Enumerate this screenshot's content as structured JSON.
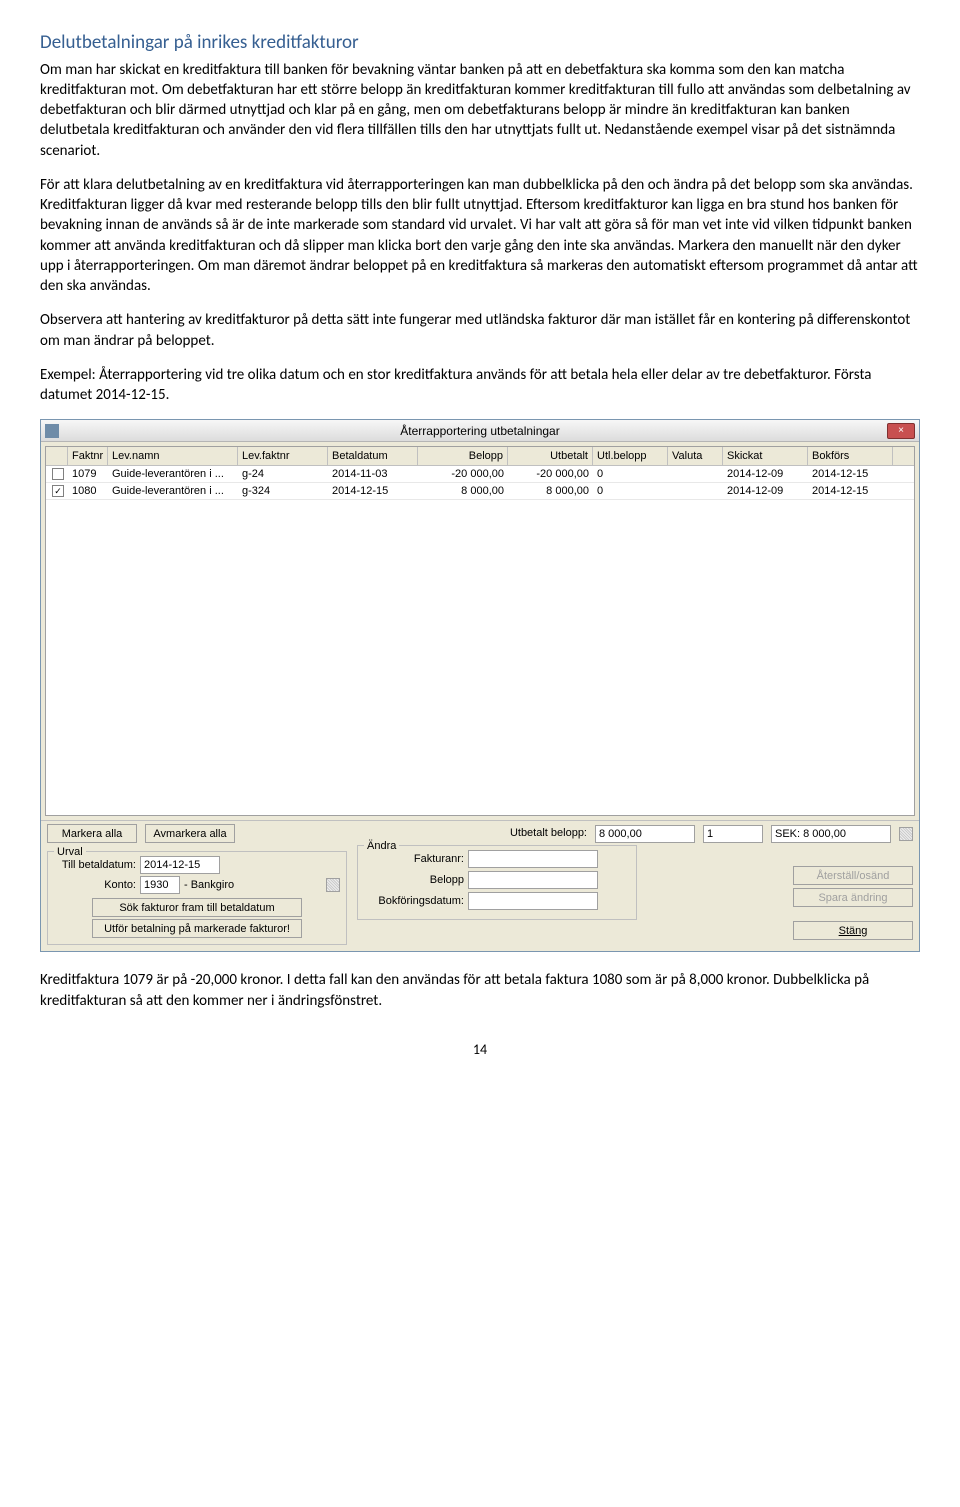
{
  "heading": "Delutbetalningar på inrikes kreditfakturor",
  "para1": "Om man har skickat en kreditfaktura till banken för bevakning väntar banken på att en debetfaktura ska komma som den kan matcha kreditfakturan mot. Om debetfakturan har ett större belopp än kreditfakturan kommer kreditfakturan till fullo att användas som delbetalning av debetfakturan och blir därmed utnyttjad och klar på en gång, men om debetfakturans belopp är mindre än kreditfakturan kan banken delutbetala kreditfakturan och använder den vid flera tillfällen tills den har utnyttjats fullt ut. Nedanstående exempel visar på det sistnämnda scenariot.",
  "para2": "För att klara delutbetalning av en kreditfaktura vid återrapporteringen kan man dubbelklicka på den och ändra på det belopp som ska användas. Kreditfakturan ligger då kvar med resterande belopp tills den blir fullt utnyttjad. Eftersom kreditfakturor kan ligga en bra stund hos banken för bevakning innan de används så är de inte markerade som standard vid urvalet. Vi har valt att göra så för man vet inte vid vilken tidpunkt banken kommer att använda kreditfakturan och då slipper man klicka bort den varje gång den inte ska användas. Markera den manuellt när den dyker upp i återrapporteringen. Om man däremot ändrar beloppet på en kreditfaktura så markeras den automatiskt eftersom programmet då antar att den ska användas.",
  "para3": "Observera att hantering av kreditfakturor på detta sätt inte fungerar med utländska fakturor där man istället får en kontering på differenskontot om man ändrar på beloppet.",
  "para4": "Exempel: Återrapportering vid tre olika datum och en stor kreditfaktura används för att betala hela eller delar av tre debetfakturor. Första datumet 2014-12-15.",
  "window": {
    "title": "Återrapportering utbetalningar",
    "close": "×",
    "headers": {
      "faktnr": "Faktnr",
      "levnamn": "Lev.namn",
      "levfaktnr": "Lev.faktnr",
      "betaldatum": "Betaldatum",
      "belopp": "Belopp",
      "utbetalt": "Utbetalt",
      "utlbelopp": "Utl.belopp",
      "valuta": "Valuta",
      "skickat": "Skickat",
      "bokfors": "Bokförs"
    },
    "rows": [
      {
        "checked": "",
        "faktnr": "1079",
        "levnamn": "Guide-leverantören i ...",
        "levfaktnr": "g-24",
        "betaldatum": "2014-11-03",
        "belopp": "-20 000,00",
        "utbetalt": "-20 000,00",
        "utlbelopp": "0",
        "valuta": "",
        "skickat": "2014-12-09",
        "bokfors": "2014-12-15"
      },
      {
        "checked": "✓",
        "faktnr": "1080",
        "levnamn": "Guide-leverantören i ...",
        "levfaktnr": "g-324",
        "betaldatum": "2014-12-15",
        "belopp": "8 000,00",
        "utbetalt": "8 000,00",
        "utlbelopp": "0",
        "valuta": "",
        "skickat": "2014-12-09",
        "bokfors": "2014-12-15"
      }
    ],
    "buttons": {
      "markera_alla": "Markera alla",
      "avmarkera_alla": "Avmarkera alla",
      "sok": "Sök fakturor fram till betaldatum",
      "utfor": "Utför betalning på markerade fakturor!",
      "aterstall": "Återställ/osänd",
      "spara": "Spara ändring",
      "stang": "Stäng"
    },
    "labels": {
      "utbetalt_belopp": "Utbetalt belopp:",
      "urval": "Urval",
      "andra": "Ändra",
      "till_betaldatum": "Till betaldatum:",
      "konto": "Konto:",
      "bankgiro": "- Bankgiro",
      "fakturanr": "Fakturanr:",
      "belopp": "Belopp",
      "bokforingsdatum": "Bokföringsdatum:"
    },
    "values": {
      "utbetalt_belopp": "8 000,00",
      "count": "1",
      "sek": "SEK: 8 000,00",
      "till_betaldatum": "2014-12-15",
      "konto": "1930"
    }
  },
  "caption": "Kreditfaktura 1079 är på -20,000 kronor. I detta fall kan den användas för att betala faktura 1080 som är på 8,000 kronor. Dubbelklicka på kreditfakturan så att den kommer ner i ändringsfönstret.",
  "page_num": "14"
}
